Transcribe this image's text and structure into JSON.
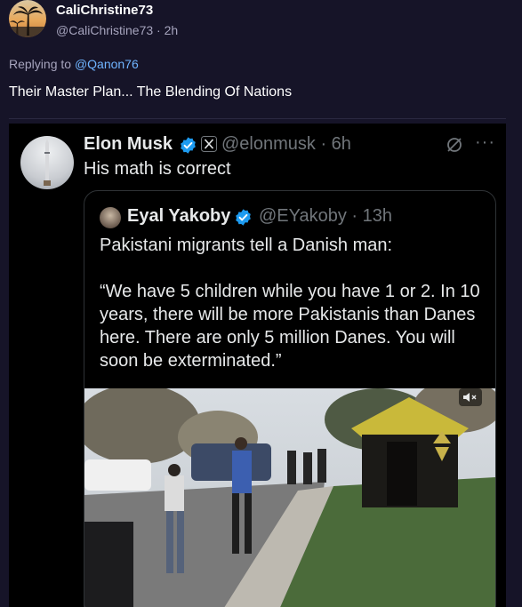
{
  "post": {
    "display_name": "CaliChristine73",
    "handle_time": "@CaliChristine73 · 2h",
    "replying_prefix": "Replying to ",
    "replying_to": "@Qanon76",
    "text": "Their Master Plan... The Blending Of Nations"
  },
  "embed": {
    "name": "Elon Musk",
    "handle_time": "@elonmusk · 6h",
    "text": "His math is correct",
    "more": "···",
    "quote": {
      "name": "Eyal Yakoby",
      "handle_time": "@EYakoby · 13h",
      "text": "Pakistani migrants tell a Danish man:\n\n“We have 5 children while you have 1 or 2. In 10 years, there will be more Pakistanis than Danes here. There are only 5 million Danes. You will soon be exterminated.”"
    }
  },
  "colors": {
    "page_bg": "#161428",
    "verified_blue": "#1d9bf0",
    "link_blue": "#6fb4ff",
    "muted_text": "#a6a4bd"
  },
  "icons": [
    "verified-badge-icon",
    "x-logo-icon",
    "grok-icon",
    "more-icon",
    "mute-icon"
  ]
}
